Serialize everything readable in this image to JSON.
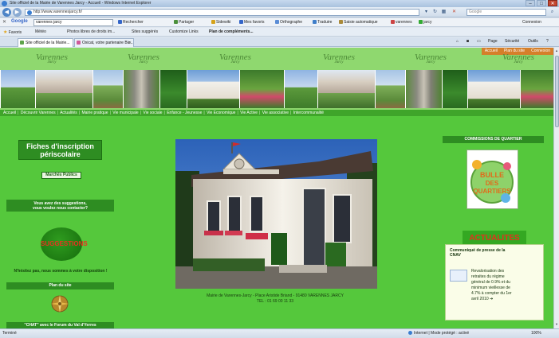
{
  "browser": {
    "window_title": "Site officiel de la Mairie de Varennes Jarcy - Accueil - Windows Internet Explorer",
    "url": "http://www.varennesjarcy.fr/",
    "search_placeholder": "Google",
    "google_query": "varennes jarcy",
    "toolbar": {
      "google_label": "Google",
      "rechercher": "Rechercher",
      "partager": "Partager",
      "sidewiki": "Sidewiki",
      "mes_favoris": "Mes favoris",
      "orthographe": "Orthographe",
      "traduire": "Traduire",
      "saisie": "Saisie automatique",
      "tag1": "varennes",
      "tag2": "jarcy",
      "connexion": "Connexion"
    },
    "favorites": {
      "label": "Favoris",
      "items": [
        "Météo",
        "Photos libres de droits im...",
        "Sites suggérés",
        "Customize Links",
        "Plan de compléments..."
      ]
    },
    "tabs": [
      {
        "label": "Site officiel de la Mairie..."
      },
      {
        "label": "Oxicat, votre partenaire Bio..."
      }
    ],
    "commands": {
      "page": "Page",
      "securite": "Sécurité",
      "outils": "Outils"
    },
    "status": {
      "left": "Terminé",
      "zone": "Internet | Mode protégé : activé",
      "zoom": "100%"
    }
  },
  "site": {
    "header_tabs": [
      "Accueil",
      "Plan du site",
      "Connexion"
    ],
    "logo_text": "Varennes",
    "logo_sub": "Jarcy",
    "nav": [
      "Accueil",
      "Découvrir Varennes",
      "Actualités",
      "Mairie pratique",
      "Vie municipale",
      "Vie sociale",
      "Enfance - Jeunesse",
      "Vie Economique",
      "Vie Active",
      "Vie associative",
      "Intercommunalité"
    ],
    "left": {
      "fiches_line1": "Fiches d'inscription",
      "fiches_line2": "périscolaire",
      "marches": "Marchés Publics",
      "suggestions_line1": "Vous avez des suggestions,",
      "suggestions_line2": "vous voulez nous contacter?",
      "suggestions_button": "SUGGESTIONS",
      "hesitez": "N'hésitez pas, nous sommes à votre disposition !",
      "plan_du_site": "Plan du site",
      "chat": "\"CHAT\" avec le Forum du Val d'Yerres"
    },
    "center": {
      "caption_line1": "Mairie de Varennes-Jarcy - Place Aristide Briand - 91480 VARENNES JARCY",
      "caption_line2": "TEL : 01 69 00 11 33"
    },
    "right": {
      "commissions": "COMMISSIONS DE QUARTIER",
      "badge_line1": "BULLE",
      "badge_line2": "DES",
      "badge_line3": "QUARTIERS",
      "actualites": "ACTUALITES",
      "news_headline": "Communiqué de presse de la CNAV",
      "news_body": "Revalorisation des retraites du régime général de 0.9% et du minimum vieillesse de 4.7% à compter du 1er avril 2010 ➜"
    }
  }
}
